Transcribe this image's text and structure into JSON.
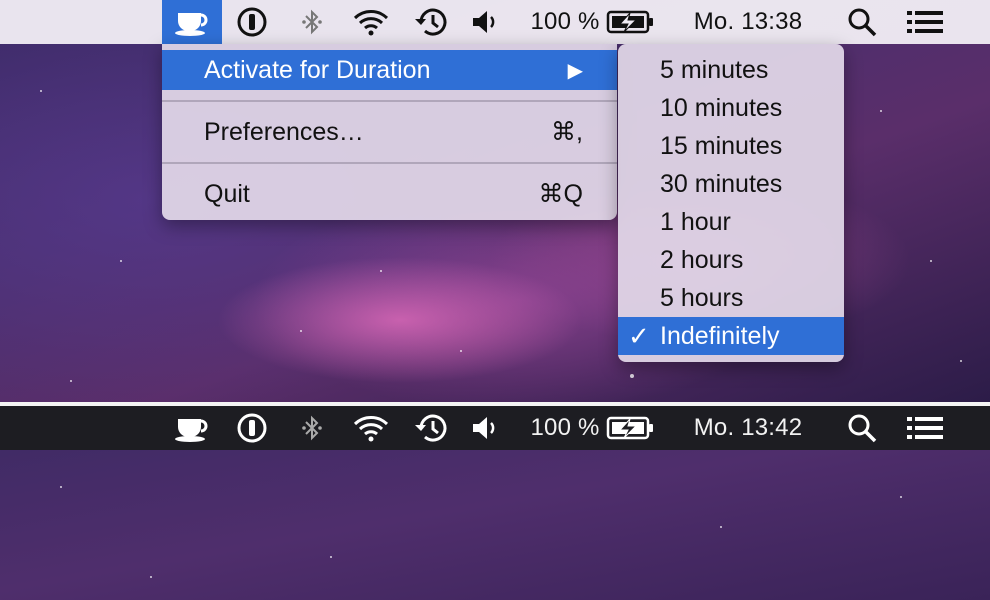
{
  "top_bar": {
    "icons": [
      "coffee-cup-icon",
      "one-password-icon",
      "bluetooth-icon",
      "wifi-icon",
      "time-machine-icon",
      "volume-icon"
    ],
    "battery_percent": "100 %",
    "clock": "Mo. 13:38",
    "right_icons": [
      "search-icon",
      "notification-center-icon"
    ]
  },
  "menu": {
    "items": [
      {
        "label": "Activate for Duration",
        "arrow": "▶"
      },
      {
        "label": "Preferences…",
        "shortcut": "⌘,"
      },
      {
        "label": "Quit",
        "shortcut": "⌘Q"
      }
    ]
  },
  "submenu": {
    "items": [
      "5 minutes",
      "10 minutes",
      "15 minutes",
      "30 minutes",
      "1 hour",
      "2 hours",
      "5 hours",
      "Indefinitely"
    ],
    "selected": "Indefinitely",
    "check": "✓"
  },
  "bottom_bar": {
    "battery_percent": "100 %",
    "clock": "Mo. 13:42"
  },
  "colors": {
    "highlight": "#2f6fd6",
    "dark_menubar": "#1d1d22",
    "light_menubar": "#f0ecf4"
  }
}
